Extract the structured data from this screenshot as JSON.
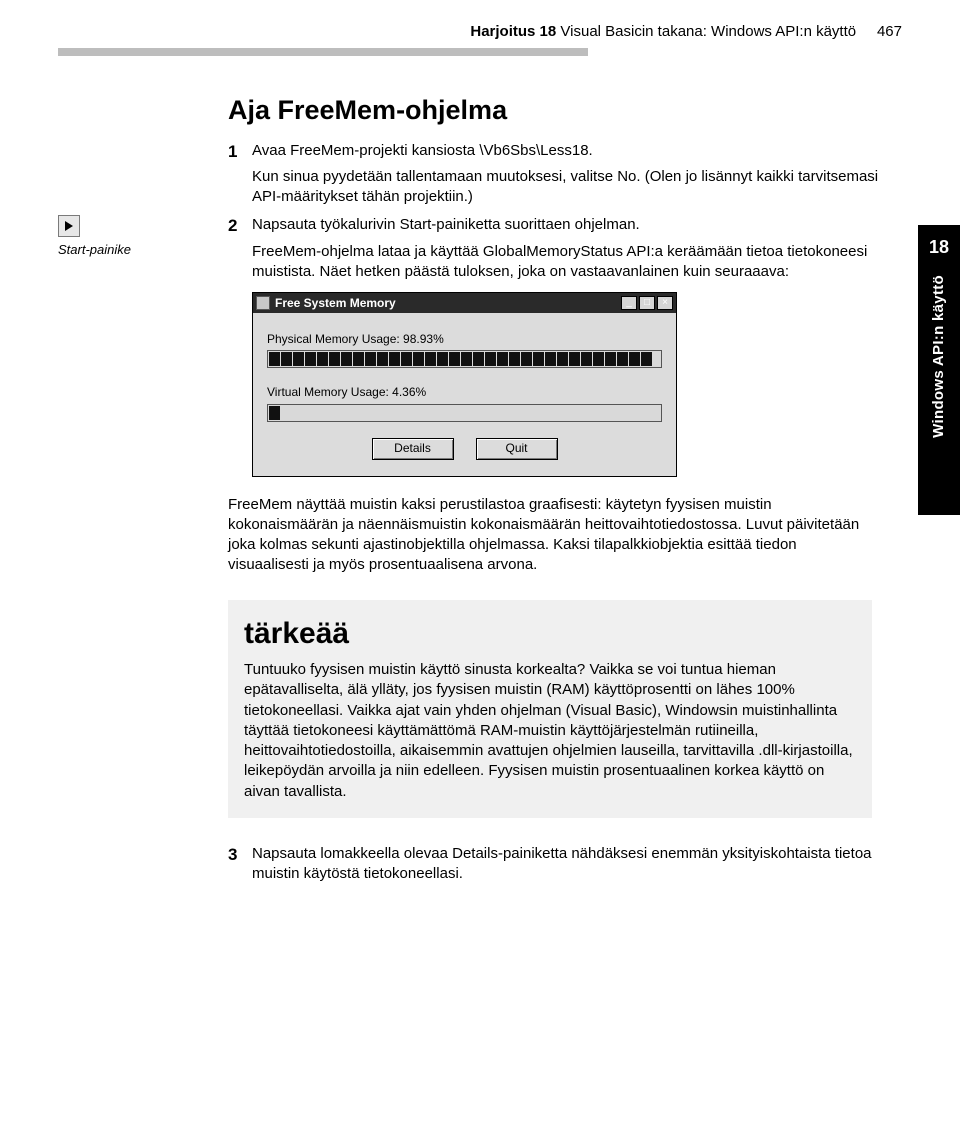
{
  "header": {
    "prefix": "Harjoitus 18",
    "title": "Visual Basicin takana: Windows API:n käyttö",
    "page_no": "467"
  },
  "sidebar_tab": {
    "chapter": "18",
    "label": "Windows API:n käyttö"
  },
  "section": {
    "title": "Aja FreeMem-ohjelma"
  },
  "gutter": {
    "start_caption": "Start-painike"
  },
  "steps": {
    "s1": {
      "num": "1",
      "text": "Avaa FreeMem-projekti kansiosta \\Vb6Sbs\\Less18.",
      "text2": "Kun sinua pyydetään tallentamaan muutoksesi, valitse No. (Olen jo lisännyt kaikki tarvitsemasi API-määritykset tähän projektiin.)"
    },
    "s2": {
      "num": "2",
      "text": "Napsauta työkalurivin Start-painiketta suorittaen ohjelman.",
      "text2": "FreeMem-ohjelma lataa ja käyttää GlobalMemoryStatus API:a keräämään tietoa tietokoneesi muistista. Näet hetken päästä tuloksen, joka on vastaavanlainen kuin seuraaava:"
    },
    "s3": {
      "num": "3",
      "text": "Napsauta lomakkeella olevaa Details-painiketta nähdäksesi enemmän yksityiskohtaista tietoa muistin käytöstä tietokoneellasi."
    }
  },
  "window": {
    "title": "Free System Memory",
    "phys_label": "Physical Memory Usage: 98.93%",
    "virt_label": "Virtual Memory Usage: 4.36%",
    "btn_details": "Details",
    "btn_quit": "Quit",
    "min_glyph": "_",
    "max_glyph": "□",
    "close_glyph": "×"
  },
  "body_para": "FreeMem näyttää muistin kaksi perustilastoa graafisesti: käytetyn fyysisen muistin kokonaismäärän ja näennäismuistin kokonaismäärän heittovaihtotiedostossa. Luvut päivitetään joka kolmas sekunti ajastinobjektilla ohjelmassa. Kaksi tilapalkkiobjektia esittää tiedon visuaalisesti ja myös prosentuaalisena arvona.",
  "important": {
    "heading": "tärkeää",
    "text": "Tuntuuko fyysisen muistin käyttö sinusta korkealta? Vaikka se voi tuntua hieman epätavalliselta, älä ylläty, jos fyysisen muistin (RAM) käyttöprosentti on lähes 100% tietokoneellasi. Vaikka ajat vain yhden ohjelman (Visual Basic), Windowsin muistinhallinta täyttää tietokoneesi käyttämättömä RAM-muistin käyttöjärjestelmän rutiineilla, heittovaihtotiedostoilla, aikaisemmin avattujen ohjelmien lauseilla, tarvittavilla .dll-kirjastoilla, leikepöydän arvoilla ja niin edelleen. Fyysisen muistin prosentuaalinen korkea käyttö on aivan tavallista."
  }
}
